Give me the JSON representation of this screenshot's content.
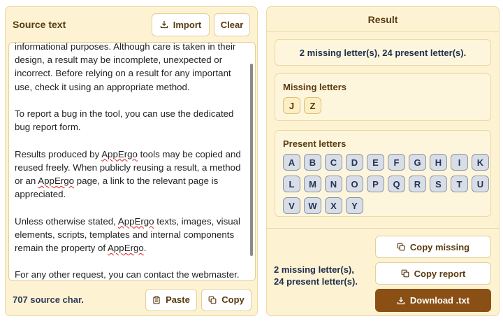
{
  "source": {
    "title": "Source text",
    "import_label": "Import",
    "clear_label": "Clear",
    "paste_label": "Paste",
    "copy_label": "Copy",
    "char_count": "707 source char.",
    "paragraphs": [
      {
        "a": "informational purposes. Although care is taken in their design, a result may be incomplete, unexpected or incorrect. Before relying on a result for any important use, check it using an appropriate method."
      },
      {
        "a": "To report a bug in the tool, you can use the dedicated bug report form."
      },
      {
        "a": "Results produced by ",
        "w1": "AppErgo",
        "b": " tools may be copied and reused freely. When publicly reusing a result, a method or an ",
        "w2": "AppErgo",
        "c": " page, a link to the relevant page is appreciated."
      },
      {
        "a": "Unless otherwise stated, ",
        "w1": "AppErgo",
        "b": " texts, images, visual elements, scripts, templates and internal components remain the property of ",
        "w2": "AppErgo",
        "c": "."
      },
      {
        "a": "For any other request, you can contact the webmaster."
      }
    ]
  },
  "result": {
    "title": "Result",
    "summary": "2 missing letter(s), 24 present letter(s).",
    "missing_title": "Missing letters",
    "missing": [
      "J",
      "Z"
    ],
    "present_title": "Present letters",
    "present": [
      "A",
      "B",
      "C",
      "D",
      "E",
      "F",
      "G",
      "H",
      "I",
      "K",
      "L",
      "M",
      "N",
      "O",
      "P",
      "Q",
      "R",
      "S",
      "T",
      "U",
      "V",
      "W",
      "X",
      "Y"
    ],
    "footer_summary_line1": "2 missing letter(s),",
    "footer_summary_line2": "24 present letter(s).",
    "copy_missing_label": "Copy missing",
    "copy_report_label": "Copy report",
    "download_label": "Download .txt"
  },
  "icons": {
    "import": "download-tray-icon",
    "paste": "clipboard-icon",
    "copy": "copy-icon",
    "download": "download-tray-icon"
  },
  "colors": {
    "panel_bg": "#fdf3d3",
    "accent_brown": "#8a4f14",
    "title_brown": "#5a3a10",
    "navy_text": "#1e2d50"
  }
}
